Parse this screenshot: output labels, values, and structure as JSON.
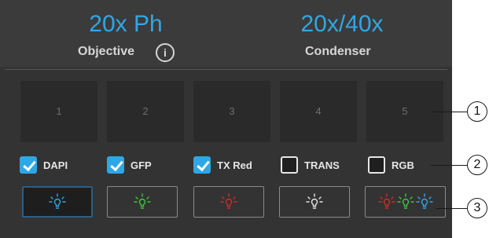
{
  "objective": {
    "value": "20x Ph",
    "label": "Objective",
    "info_icon": "info-icon"
  },
  "condenser": {
    "value": "20x/40x",
    "label": "Condenser"
  },
  "slots": [
    {
      "label": "1"
    },
    {
      "label": "2"
    },
    {
      "label": "3"
    },
    {
      "label": "4"
    },
    {
      "label": "5"
    }
  ],
  "channels": [
    {
      "label": "DAPI",
      "checked": true
    },
    {
      "label": "GFP",
      "checked": true
    },
    {
      "label": "TX Red",
      "checked": true
    },
    {
      "label": "TRANS",
      "checked": false
    },
    {
      "label": "RGB",
      "checked": false
    }
  ],
  "lamp_buttons": [
    {
      "icon": "blue-bulb-icon",
      "colors": [
        "#2fa7e6"
      ],
      "selected": true
    },
    {
      "icon": "green-bulb-icon",
      "colors": [
        "#3cc83c"
      ],
      "selected": false
    },
    {
      "icon": "red-bulb-icon",
      "colors": [
        "#d42a2a"
      ],
      "selected": false
    },
    {
      "icon": "white-bulb-icon",
      "colors": [
        "#e6e6e6"
      ],
      "selected": false
    },
    {
      "icon": "rgb-bulb-icon",
      "colors": [
        "#d42a2a",
        "#3cc83c",
        "#2fa7e6"
      ],
      "selected": false
    }
  ],
  "callouts": [
    "1",
    "2",
    "3"
  ],
  "colors": {
    "accent": "#2fa7e6",
    "panel": "#333333"
  }
}
